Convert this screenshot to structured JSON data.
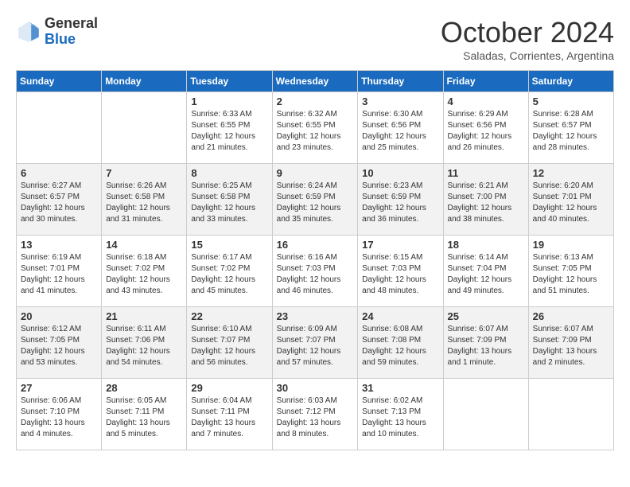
{
  "header": {
    "logo_general": "General",
    "logo_blue": "Blue",
    "month_title": "October 2024",
    "subtitle": "Saladas, Corrientes, Argentina"
  },
  "days_of_week": [
    "Sunday",
    "Monday",
    "Tuesday",
    "Wednesday",
    "Thursday",
    "Friday",
    "Saturday"
  ],
  "weeks": [
    [
      {
        "day": "",
        "info": ""
      },
      {
        "day": "",
        "info": ""
      },
      {
        "day": "1",
        "info": "Sunrise: 6:33 AM\nSunset: 6:55 PM\nDaylight: 12 hours and 21 minutes."
      },
      {
        "day": "2",
        "info": "Sunrise: 6:32 AM\nSunset: 6:55 PM\nDaylight: 12 hours and 23 minutes."
      },
      {
        "day": "3",
        "info": "Sunrise: 6:30 AM\nSunset: 6:56 PM\nDaylight: 12 hours and 25 minutes."
      },
      {
        "day": "4",
        "info": "Sunrise: 6:29 AM\nSunset: 6:56 PM\nDaylight: 12 hours and 26 minutes."
      },
      {
        "day": "5",
        "info": "Sunrise: 6:28 AM\nSunset: 6:57 PM\nDaylight: 12 hours and 28 minutes."
      }
    ],
    [
      {
        "day": "6",
        "info": "Sunrise: 6:27 AM\nSunset: 6:57 PM\nDaylight: 12 hours and 30 minutes."
      },
      {
        "day": "7",
        "info": "Sunrise: 6:26 AM\nSunset: 6:58 PM\nDaylight: 12 hours and 31 minutes."
      },
      {
        "day": "8",
        "info": "Sunrise: 6:25 AM\nSunset: 6:58 PM\nDaylight: 12 hours and 33 minutes."
      },
      {
        "day": "9",
        "info": "Sunrise: 6:24 AM\nSunset: 6:59 PM\nDaylight: 12 hours and 35 minutes."
      },
      {
        "day": "10",
        "info": "Sunrise: 6:23 AM\nSunset: 6:59 PM\nDaylight: 12 hours and 36 minutes."
      },
      {
        "day": "11",
        "info": "Sunrise: 6:21 AM\nSunset: 7:00 PM\nDaylight: 12 hours and 38 minutes."
      },
      {
        "day": "12",
        "info": "Sunrise: 6:20 AM\nSunset: 7:01 PM\nDaylight: 12 hours and 40 minutes."
      }
    ],
    [
      {
        "day": "13",
        "info": "Sunrise: 6:19 AM\nSunset: 7:01 PM\nDaylight: 12 hours and 41 minutes."
      },
      {
        "day": "14",
        "info": "Sunrise: 6:18 AM\nSunset: 7:02 PM\nDaylight: 12 hours and 43 minutes."
      },
      {
        "day": "15",
        "info": "Sunrise: 6:17 AM\nSunset: 7:02 PM\nDaylight: 12 hours and 45 minutes."
      },
      {
        "day": "16",
        "info": "Sunrise: 6:16 AM\nSunset: 7:03 PM\nDaylight: 12 hours and 46 minutes."
      },
      {
        "day": "17",
        "info": "Sunrise: 6:15 AM\nSunset: 7:03 PM\nDaylight: 12 hours and 48 minutes."
      },
      {
        "day": "18",
        "info": "Sunrise: 6:14 AM\nSunset: 7:04 PM\nDaylight: 12 hours and 49 minutes."
      },
      {
        "day": "19",
        "info": "Sunrise: 6:13 AM\nSunset: 7:05 PM\nDaylight: 12 hours and 51 minutes."
      }
    ],
    [
      {
        "day": "20",
        "info": "Sunrise: 6:12 AM\nSunset: 7:05 PM\nDaylight: 12 hours and 53 minutes."
      },
      {
        "day": "21",
        "info": "Sunrise: 6:11 AM\nSunset: 7:06 PM\nDaylight: 12 hours and 54 minutes."
      },
      {
        "day": "22",
        "info": "Sunrise: 6:10 AM\nSunset: 7:07 PM\nDaylight: 12 hours and 56 minutes."
      },
      {
        "day": "23",
        "info": "Sunrise: 6:09 AM\nSunset: 7:07 PM\nDaylight: 12 hours and 57 minutes."
      },
      {
        "day": "24",
        "info": "Sunrise: 6:08 AM\nSunset: 7:08 PM\nDaylight: 12 hours and 59 minutes."
      },
      {
        "day": "25",
        "info": "Sunrise: 6:07 AM\nSunset: 7:09 PM\nDaylight: 13 hours and 1 minute."
      },
      {
        "day": "26",
        "info": "Sunrise: 6:07 AM\nSunset: 7:09 PM\nDaylight: 13 hours and 2 minutes."
      }
    ],
    [
      {
        "day": "27",
        "info": "Sunrise: 6:06 AM\nSunset: 7:10 PM\nDaylight: 13 hours and 4 minutes."
      },
      {
        "day": "28",
        "info": "Sunrise: 6:05 AM\nSunset: 7:11 PM\nDaylight: 13 hours and 5 minutes."
      },
      {
        "day": "29",
        "info": "Sunrise: 6:04 AM\nSunset: 7:11 PM\nDaylight: 13 hours and 7 minutes."
      },
      {
        "day": "30",
        "info": "Sunrise: 6:03 AM\nSunset: 7:12 PM\nDaylight: 13 hours and 8 minutes."
      },
      {
        "day": "31",
        "info": "Sunrise: 6:02 AM\nSunset: 7:13 PM\nDaylight: 13 hours and 10 minutes."
      },
      {
        "day": "",
        "info": ""
      },
      {
        "day": "",
        "info": ""
      }
    ]
  ]
}
